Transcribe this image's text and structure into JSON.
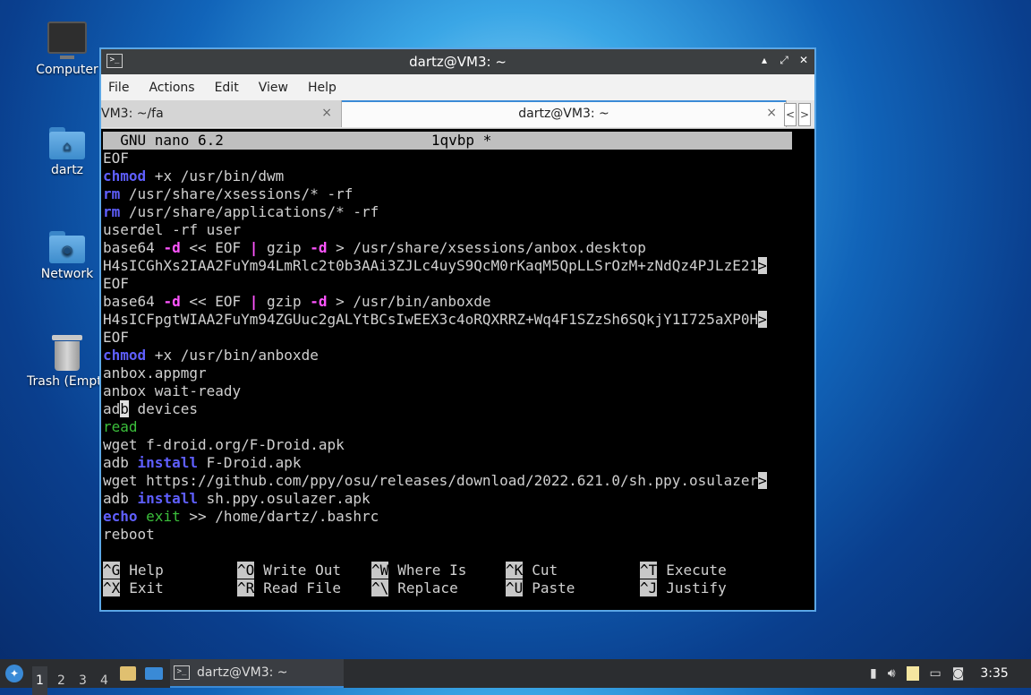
{
  "desktop": {
    "icons": [
      {
        "label": "Computer",
        "icon": "computer-icon"
      },
      {
        "label": "dartz",
        "icon": "home-folder-icon"
      },
      {
        "label": "Network",
        "icon": "network-folder-icon"
      },
      {
        "label": "Trash (Empty)",
        "icon": "trash-icon"
      }
    ]
  },
  "window": {
    "title": "dartz@VM3: ~",
    "menu": [
      "File",
      "Actions",
      "Edit",
      "View",
      "Help"
    ],
    "tabs": [
      {
        "label": "VM3: ~/fa"
      },
      {
        "label": "dartz@VM3: ~"
      }
    ],
    "tab_close": "×",
    "controls": {
      "minimize": "▴",
      "maximize": "⤢",
      "close": "✕"
    },
    "tab_nav": {
      "prev": "<",
      "next": ">"
    }
  },
  "nano": {
    "header_left": "  GNU nano 6.2",
    "header_file": "1qvbp *",
    "lines": [
      [
        {
          "t": "EOF"
        }
      ],
      [
        {
          "t": "chmod",
          "c": "kw"
        },
        {
          "t": " +x /usr/bin/dwm"
        }
      ],
      [
        {
          "t": "rm",
          "c": "kw"
        },
        {
          "t": " /usr/share/xsessions/* -rf"
        }
      ],
      [
        {
          "t": "rm",
          "c": "kw"
        },
        {
          "t": " /usr/share/applications/* -rf"
        }
      ],
      [
        {
          "t": "userdel -rf user"
        }
      ],
      [
        {
          "t": "base64 "
        },
        {
          "t": "-d",
          "c": "op"
        },
        {
          "t": " << EOF "
        },
        {
          "t": "|",
          "c": "op"
        },
        {
          "t": " gzip "
        },
        {
          "t": "-d",
          "c": "op"
        },
        {
          "t": " > /usr/share/xsessions/anbox.desktop"
        }
      ],
      [
        {
          "t": "H4sICGhXs2IAA2FuYm94LmRlc2t0b3AAi3ZJLc4uyS9QcM0rKaqM5QpLLSrOzM+zNdQz4PJLzE21"
        },
        {
          "t": ">",
          "c": "ovf"
        }
      ],
      [
        {
          "t": "EOF"
        }
      ],
      [
        {
          "t": "base64 "
        },
        {
          "t": "-d",
          "c": "op"
        },
        {
          "t": " << EOF "
        },
        {
          "t": "|",
          "c": "op"
        },
        {
          "t": " gzip "
        },
        {
          "t": "-d",
          "c": "op"
        },
        {
          "t": " > /usr/bin/anboxde"
        }
      ],
      [
        {
          "t": "H4sICFpgtWIAA2FuYm94ZGUuc2gALYtBCsIwEEX3c4oRQXRRZ+Wq4F1SZzSh6SQkjY1I725aXP0H"
        },
        {
          "t": ">",
          "c": "ovf"
        }
      ],
      [
        {
          "t": "EOF"
        }
      ],
      [
        {
          "t": "chmod",
          "c": "kw"
        },
        {
          "t": " +x /usr/bin/anboxde"
        }
      ],
      [
        {
          "t": "anbox.appmgr"
        }
      ],
      [
        {
          "t": "anbox wait-ready"
        }
      ],
      [
        {
          "t": "ad"
        },
        {
          "t": "b",
          "c": "cur"
        },
        {
          "t": " devices"
        }
      ],
      [
        {
          "t": "read",
          "c": "gr"
        }
      ],
      [
        {
          "t": "wget f-droid.org/F-Droid.apk"
        }
      ],
      [
        {
          "t": "adb "
        },
        {
          "t": "install",
          "c": "kw"
        },
        {
          "t": " F-Droid.apk"
        }
      ],
      [
        {
          "t": "wget https://github.com/ppy/osu/releases/download/2022.621.0/sh.ppy.osulazer"
        },
        {
          "t": ">",
          "c": "ovf"
        }
      ],
      [
        {
          "t": "adb "
        },
        {
          "t": "install",
          "c": "kw"
        },
        {
          "t": " sh.ppy.osulazer.apk"
        }
      ],
      [
        {
          "t": "echo",
          "c": "kw"
        },
        {
          "t": " "
        },
        {
          "t": "exit",
          "c": "gr"
        },
        {
          "t": " >> /home/dartz/.bashrc"
        }
      ],
      [
        {
          "t": "reboot"
        }
      ]
    ],
    "shortcuts": [
      [
        {
          "k": "^G",
          "l": "Help"
        },
        {
          "k": "^O",
          "l": "Write Out"
        },
        {
          "k": "^W",
          "l": "Where Is"
        },
        {
          "k": "^K",
          "l": "Cut"
        },
        {
          "k": "^T",
          "l": "Execute"
        }
      ],
      [
        {
          "k": "^X",
          "l": "Exit"
        },
        {
          "k": "^R",
          "l": "Read File"
        },
        {
          "k": "^\\",
          "l": "Replace"
        },
        {
          "k": "^U",
          "l": "Paste"
        },
        {
          "k": "^J",
          "l": "Justify"
        }
      ]
    ]
  },
  "taskbar": {
    "workspaces": [
      "1",
      "2",
      "3",
      "4"
    ],
    "active_workspace": "1",
    "task_label": "dartz@VM3: ~",
    "clock": "3:35",
    "tray_icons": [
      "clipboard-icon",
      "volume-icon",
      "notes-icon",
      "network-icon",
      "notification-icon"
    ]
  }
}
